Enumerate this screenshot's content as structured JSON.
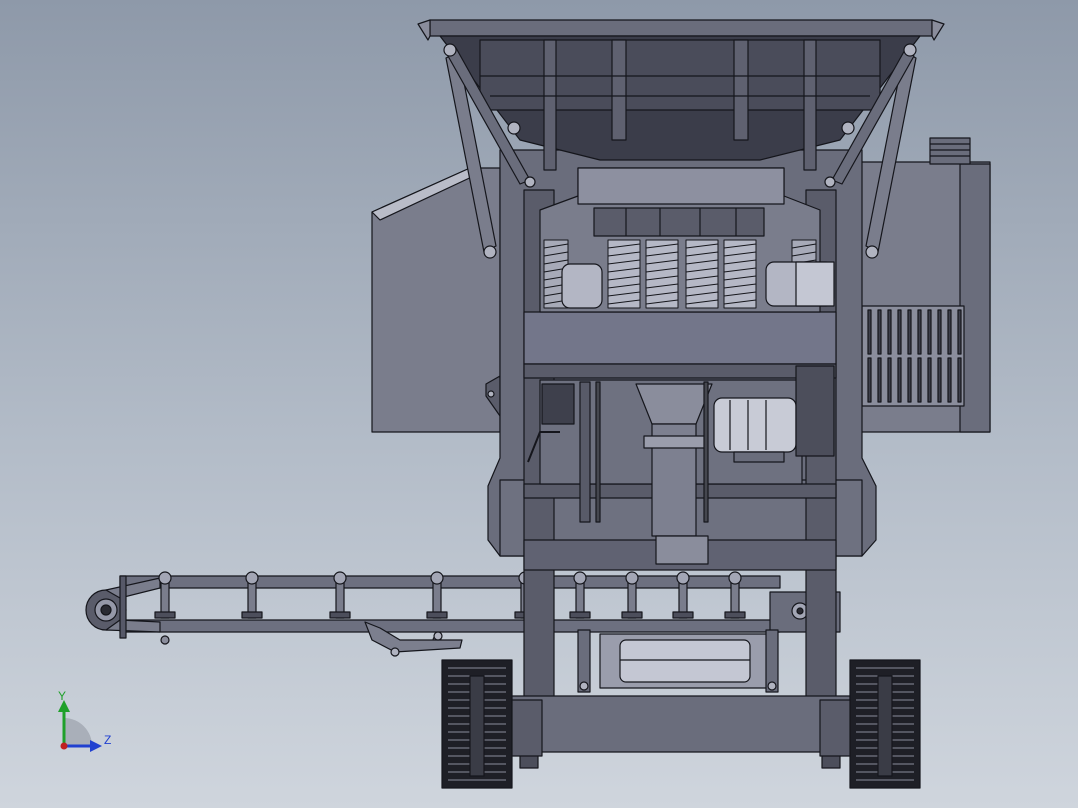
{
  "viewport": {
    "background_top": "#8e99a9",
    "background_bottom": "#cfd5dd"
  },
  "model": {
    "part_fill": "#5f6170",
    "part_fill_light": "#8d90a0",
    "part_fill_dark": "#3c3e4a",
    "edge_color": "#15161c"
  },
  "triad": {
    "y_label": "Y",
    "z_label": "Z",
    "y_color": "#1fa02a",
    "z_color": "#2040d0",
    "x_color": "#c02020"
  }
}
